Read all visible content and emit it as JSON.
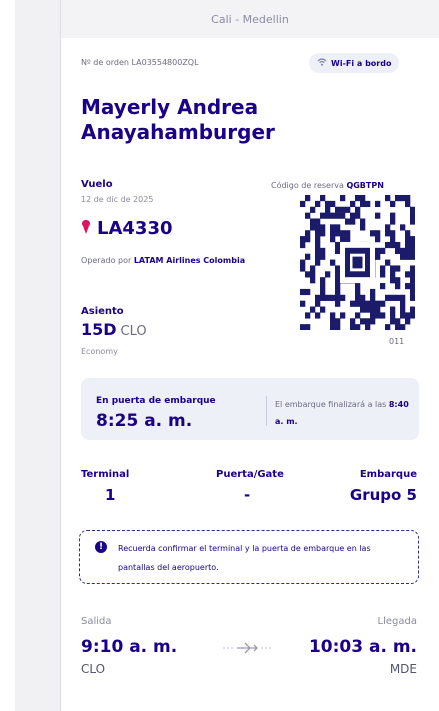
{
  "route": "Cali - Medellin",
  "order_number": "Nº de orden LA03554800ZQL",
  "wifi": {
    "icon": "wifi-icon",
    "label": "Wi-Fi a bordo"
  },
  "passenger": {
    "name": "Mayerly Andrea Anayahamburger"
  },
  "flight": {
    "label": "Vuelo",
    "date": "12 de dic de 2025",
    "number": "LA4330",
    "operated_prefix": "Operado por",
    "operated_by": "LATAM Airlines Colombia"
  },
  "reservation": {
    "label": "Código de reserva",
    "code": "QGBTPN",
    "sequence": "011"
  },
  "seat": {
    "label": "Asiento",
    "number": "15D",
    "origin": "CLO",
    "cabin": "Economy"
  },
  "boarding": {
    "status": "En puerta de embarque",
    "time": "8:25 a. m.",
    "ends_text": "El embarque finalizará a las",
    "ends_time": "8:40 a. m."
  },
  "details": {
    "terminal_label": "Terminal",
    "terminal_value": "1",
    "gate_label": "Puerta/Gate",
    "gate_value": "-",
    "group_label": "Embarque",
    "group_value": "Grupo 5"
  },
  "notice": {
    "icon": "info-icon",
    "text": "Recuerda confirmar el terminal y la puerta de embarque en las pantallas del aeropuerto."
  },
  "departure": {
    "label": "Salida",
    "time": "9:10 a. m.",
    "code": "CLO"
  },
  "arrival": {
    "label": "Llegada",
    "time": "10:03 a. m.",
    "code": "MDE"
  },
  "colors": {
    "brand_navy": "#1b0088",
    "brand_pink": "#e0115f",
    "muted": "#8b8ba0",
    "box_bg": "#eef0f8"
  }
}
